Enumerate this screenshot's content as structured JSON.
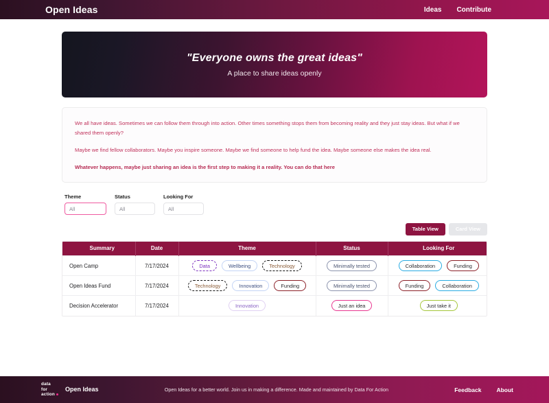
{
  "header": {
    "brand": "Open Ideas",
    "nav": [
      {
        "label": "Ideas"
      },
      {
        "label": "Contribute"
      }
    ]
  },
  "hero": {
    "title": "\"Everyone owns the great ideas\"",
    "subtitle": "A place to share ideas openly"
  },
  "intro": {
    "paragraph1": "We all have ideas. Sometimes we can follow them through into action. Other times something stops them from becoming reality and they just stay ideas. But what if we shared them openly?",
    "paragraph2": "Maybe we find fellow collaborators. Maybe you inspire someone. Maybe we find someone to help fund the idea. Maybe someone else makes the idea real.",
    "paragraph3": "Whatever happens, maybe just sharing an idea is the first step to making it a reality. You can do that here"
  },
  "filters": [
    {
      "label": "Theme",
      "value": "All",
      "focused": true
    },
    {
      "label": "Status",
      "value": "All",
      "focused": false
    },
    {
      "label": "Looking For",
      "value": "All",
      "focused": false
    }
  ],
  "view_toggle": {
    "table_label": "Table View",
    "card_label": "Card View",
    "active": "Table View",
    "active_bg": "#8e1441",
    "inactive_bg": "#e6e7ea"
  },
  "table": {
    "columns": [
      "Summary",
      "Date",
      "Theme",
      "Status",
      "Looking For"
    ],
    "header_bg": "#8e1441",
    "rows": [
      {
        "summary": "Open Camp",
        "date": "7/17/2024",
        "theme": [
          {
            "label": "Data",
            "border": "#7b2fbe",
            "text": "#7b2fbe",
            "style": "dashed"
          },
          {
            "label": "Wellbeing",
            "border": "#c3d4f5",
            "text": "#3d4f80",
            "style": "solid"
          },
          {
            "label": "Technology",
            "border": "#111111",
            "text": "#8a5a34",
            "style": "dashed"
          }
        ],
        "status": [
          {
            "label": "Minimally tested",
            "border": "#8b93ad",
            "text": "#4a5470",
            "style": "solid"
          }
        ],
        "looking_for": [
          {
            "label": "Collaboration",
            "border": "#29abe2",
            "text": "#2a2a2e",
            "style": "solid"
          },
          {
            "label": "Funding",
            "border": "#8b2028",
            "text": "#2a2a2e",
            "style": "solid"
          }
        ]
      },
      {
        "summary": "Open Ideas Fund",
        "date": "7/17/2024",
        "theme": [
          {
            "label": "Technology",
            "border": "#111111",
            "text": "#8a5a34",
            "style": "dashed"
          },
          {
            "label": "Innovation",
            "border": "#c3d4f5",
            "text": "#3d4f80",
            "style": "solid"
          },
          {
            "label": "Funding",
            "border": "#8b2028",
            "text": "#2a2a2e",
            "style": "solid"
          }
        ],
        "status": [
          {
            "label": "Minimally tested",
            "border": "#8b93ad",
            "text": "#4a5470",
            "style": "solid"
          }
        ],
        "looking_for": [
          {
            "label": "Funding",
            "border": "#8b2028",
            "text": "#2a2a2e",
            "style": "solid"
          },
          {
            "label": "Collaboration",
            "border": "#29abe2",
            "text": "#2a2a2e",
            "style": "solid"
          }
        ]
      },
      {
        "summary": "Decision Accelerator",
        "date": "7/17/2024",
        "theme": [
          {
            "label": "Innovation",
            "border": "#e0d0f2",
            "text": "#8a63c4",
            "style": "solid"
          }
        ],
        "status": [
          {
            "label": "Just an idea",
            "border": "#e8368f",
            "text": "#2a2a2e",
            "style": "solid"
          }
        ],
        "looking_for": [
          {
            "label": "Just take it",
            "border": "#a4c639",
            "text": "#2a2a2e",
            "style": "solid"
          }
        ]
      }
    ]
  },
  "footer": {
    "logo_line1": "data",
    "logo_line2": "for",
    "logo_line3": "action",
    "brand": "Open Ideas",
    "tagline": "Open Ideas for a better world. Join us in making a difference. Made and maintained by Data For Action",
    "links": [
      {
        "label": "Feedback"
      },
      {
        "label": "About"
      }
    ]
  }
}
